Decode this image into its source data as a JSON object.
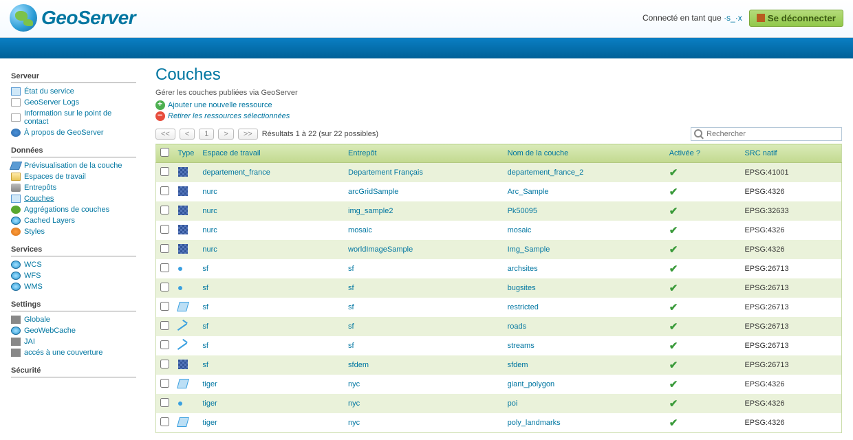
{
  "header": {
    "app_name": "GeoServer",
    "login_status_prefix": "Connecté en tant que",
    "username": "·s_·x",
    "logout_label": "Se déconnecter"
  },
  "sidebar": {
    "sections": [
      {
        "title": "Serveur",
        "items": [
          {
            "label": "État du service",
            "icon": "i-doc-blue"
          },
          {
            "label": "GeoServer Logs",
            "icon": "i-doc"
          },
          {
            "label": "Information sur le point de contact",
            "icon": "i-doc"
          },
          {
            "label": "À propos de GeoServer",
            "icon": "i-info"
          }
        ]
      },
      {
        "title": "Données",
        "items": [
          {
            "label": "Prévisualisation de la couche",
            "icon": "i-layer"
          },
          {
            "label": "Espaces de travail",
            "icon": "i-folder"
          },
          {
            "label": "Entrepôts",
            "icon": "i-db"
          },
          {
            "label": "Couches",
            "icon": "i-doc-blue",
            "current": true
          },
          {
            "label": "Aggrégations de couches",
            "icon": "i-green"
          },
          {
            "label": "Cached Layers",
            "icon": "i-globe"
          },
          {
            "label": "Styles",
            "icon": "i-style"
          }
        ]
      },
      {
        "title": "Services",
        "items": [
          {
            "label": "WCS",
            "icon": "i-globe"
          },
          {
            "label": "WFS",
            "icon": "i-globe"
          },
          {
            "label": "WMS",
            "icon": "i-globe"
          }
        ]
      },
      {
        "title": "Settings",
        "items": [
          {
            "label": "Globale",
            "icon": "i-wrench"
          },
          {
            "label": "GeoWebCache",
            "icon": "i-globe"
          },
          {
            "label": "JAI",
            "icon": "i-wrench"
          },
          {
            "label": "accés à une couverture",
            "icon": "i-wrench"
          }
        ]
      },
      {
        "title": "Sécurité",
        "items": []
      }
    ]
  },
  "page": {
    "title": "Couches",
    "description": "Gérer les couches publiées via GeoServer",
    "add_label": "Ajouter une nouvelle ressource",
    "remove_label": "Retirer les ressources sélectionnées"
  },
  "pager": {
    "first": "<<",
    "prev": "<",
    "page": "1",
    "next": ">",
    "last": ">>",
    "results_text": "Résultats 1 à 22 (sur 22 possibles)"
  },
  "search": {
    "placeholder": "Rechercher"
  },
  "table": {
    "headers": {
      "type": "Type",
      "workspace": "Espace de travail",
      "store": "Entrepôt",
      "name": "Nom de la couche",
      "enabled": "Activée ?",
      "srs": "SRC natif"
    },
    "rows": [
      {
        "type": "raster",
        "workspace": "departement_france",
        "store": "Departement Français",
        "name": "departement_france_2",
        "enabled": true,
        "srs": "EPSG:41001"
      },
      {
        "type": "raster",
        "workspace": "nurc",
        "store": "arcGridSample",
        "name": "Arc_Sample",
        "enabled": true,
        "srs": "EPSG:4326"
      },
      {
        "type": "raster",
        "workspace": "nurc",
        "store": "img_sample2",
        "name": "Pk50095",
        "enabled": true,
        "srs": "EPSG:32633"
      },
      {
        "type": "raster",
        "workspace": "nurc",
        "store": "mosaic",
        "name": "mosaic",
        "enabled": true,
        "srs": "EPSG:4326"
      },
      {
        "type": "raster",
        "workspace": "nurc",
        "store": "worldImageSample",
        "name": "Img_Sample",
        "enabled": true,
        "srs": "EPSG:4326"
      },
      {
        "type": "point",
        "workspace": "sf",
        "store": "sf",
        "name": "archsites",
        "enabled": true,
        "srs": "EPSG:26713"
      },
      {
        "type": "point",
        "workspace": "sf",
        "store": "sf",
        "name": "bugsites",
        "enabled": true,
        "srs": "EPSG:26713"
      },
      {
        "type": "poly",
        "workspace": "sf",
        "store": "sf",
        "name": "restricted",
        "enabled": true,
        "srs": "EPSG:26713"
      },
      {
        "type": "line",
        "workspace": "sf",
        "store": "sf",
        "name": "roads",
        "enabled": true,
        "srs": "EPSG:26713"
      },
      {
        "type": "line",
        "workspace": "sf",
        "store": "sf",
        "name": "streams",
        "enabled": true,
        "srs": "EPSG:26713"
      },
      {
        "type": "raster",
        "workspace": "sf",
        "store": "sfdem",
        "name": "sfdem",
        "enabled": true,
        "srs": "EPSG:26713"
      },
      {
        "type": "poly",
        "workspace": "tiger",
        "store": "nyc",
        "name": "giant_polygon",
        "enabled": true,
        "srs": "EPSG:4326"
      },
      {
        "type": "point",
        "workspace": "tiger",
        "store": "nyc",
        "name": "poi",
        "enabled": true,
        "srs": "EPSG:4326"
      },
      {
        "type": "poly",
        "workspace": "tiger",
        "store": "nyc",
        "name": "poly_landmarks",
        "enabled": true,
        "srs": "EPSG:4326"
      }
    ]
  }
}
